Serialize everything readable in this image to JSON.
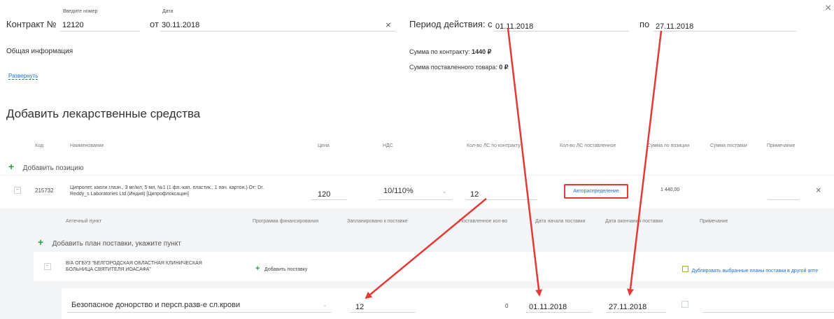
{
  "contract": {
    "label": "Контракт №",
    "number_caption": "Введите номер",
    "number_value": "12120",
    "date_prefix": "от",
    "date_caption": "Дата",
    "date_value": "30.11.2018",
    "clear_symbol": "×"
  },
  "period": {
    "label": "Период действия: с",
    "from_value": "01.11.2018",
    "to_label": "по",
    "to_value": "27.11.2018"
  },
  "close_symbol": "×",
  "general": {
    "title": "Общая информация",
    "expand_link": "Развернуть"
  },
  "sums": {
    "contract_label": "Сумма по контракту:",
    "contract_value": "1440 ₽",
    "delivered_label": "Сумма поставленного товара:",
    "delivered_value": "0 ₽"
  },
  "section_title": "Добавить лекарственные средства",
  "table_headers": {
    "code": "Код",
    "name": "Наименование",
    "price": "Цена",
    "vat": "НДС",
    "qty_contract": "Кол-во ЛС по контракту",
    "qty_delivered": "Кол-во ЛС поставленное",
    "sum_position": "Сумма по позиции",
    "sum_delivery": "Сумма поставки",
    "note": "Примечание"
  },
  "add_position": "Добавить позицию",
  "position": {
    "code": "215732",
    "name_line1": "Ципролет, капли глазн., 3 мг/мл, 5 мл, №1 (1 фл.-кап. пластик., 1 пач. картон.) От: Dr.",
    "name_line2": "Reddy_s Laboratories Ltd.(Индия) [Ципрофлоксацин]",
    "price": "120",
    "vat": "10/110%",
    "qty": "12",
    "autodistribute_button": "Автораспределение",
    "sum": "1 440,00",
    "remove_symbol": "×",
    "collapse_symbol": "-"
  },
  "sub_headers": {
    "pharmacy": "Аптечный пункт",
    "program": "Программа финансирования",
    "planned": "Запланировано к поставке",
    "delivered_qty": "Поставленное кол-во",
    "start_date": "Дата начала поставки",
    "end_date": "Дата окончания поставки",
    "note": "Примечание"
  },
  "add_plan": "Добавить план поставки, укажите пункт",
  "pharmacy_row": {
    "name_line1": "В/А ОГБУЗ \"БЕЛГОРОДСКАЯ ОБЛАСТНАЯ КЛИНИЧЕСКАЯ",
    "name_line2": "БОЛЬНИЦА СВЯТИТЕЛЯ ИОАСАФА\"",
    "add_delivery": "Добавить поставку",
    "duplicate_link": "Дублировать выбранные планы поставки в другой апте",
    "collapse_symbol": "-"
  },
  "plan_row": {
    "program": "Безопасное донорство и персп.разв-е сл.крови",
    "planned": "12",
    "delivered": "0",
    "start": "01.11.2018",
    "end": "27.11.2018"
  },
  "colors": {
    "accent_link": "#1f6fd1",
    "arrow_red": "#e53935",
    "plus_green": "#2e9e3f",
    "highlight_border": "#e53935"
  }
}
